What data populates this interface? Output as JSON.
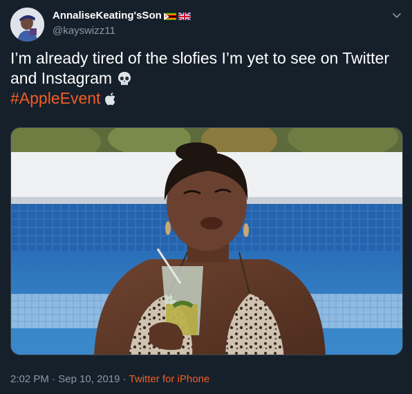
{
  "user": {
    "display_name": "AnnaliseKeating'sSon",
    "handle": "@kayswizz11",
    "flags": [
      "zimbabwe-flag-icon",
      "uk-flag-icon"
    ]
  },
  "tweet": {
    "line1": "I’m already tired of the slofies I’m yet to see on Twitter",
    "line2": "and Instagram",
    "hashtag": "#AppleEvent",
    "emojis": [
      "skull-emoji-icon",
      "apple-logo-icon"
    ]
  },
  "meta": {
    "time": "2:02 PM",
    "separator1": " · ",
    "date": "Sep 10, 2019",
    "separator2": " · ",
    "source": "Twitter for iPhone"
  },
  "colors": {
    "background": "#15202b",
    "accent": "#f45d22",
    "secondary_text": "#8899a6"
  }
}
